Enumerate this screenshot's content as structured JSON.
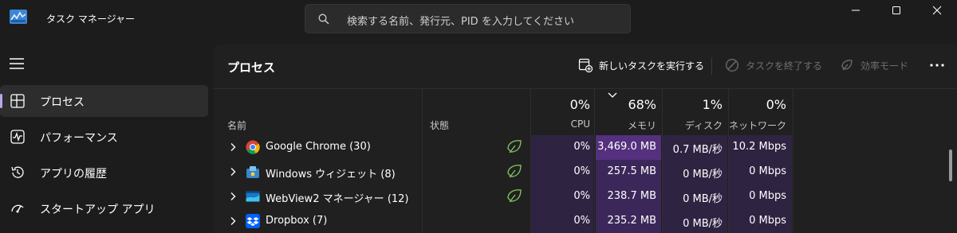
{
  "app": {
    "title": "タスク マネージャー"
  },
  "search": {
    "placeholder": "検索する名前、発行元、PID を入力してください"
  },
  "sidebar": {
    "items": [
      {
        "label": "プロセス",
        "icon": "processes-icon",
        "active": true
      },
      {
        "label": "パフォーマンス",
        "icon": "performance-icon",
        "active": false
      },
      {
        "label": "アプリの履歴",
        "icon": "history-icon",
        "active": false
      },
      {
        "label": "スタートアップ アプリ",
        "icon": "startup-icon",
        "active": false
      }
    ]
  },
  "toolbar": {
    "title": "プロセス",
    "run_new_task": "新しいタスクを実行する",
    "end_task": "タスクを終了する",
    "efficiency_mode": "効率モード"
  },
  "columns": {
    "name": "名前",
    "status": "状態",
    "cpu": {
      "label": "CPU",
      "percent": "0%"
    },
    "memory": {
      "label": "メモリ",
      "percent": "68%"
    },
    "disk": {
      "label": "ディスク",
      "percent": "1%"
    },
    "network": {
      "label": "ネットワーク",
      "percent": "0%"
    }
  },
  "processes": [
    {
      "name": "Google Chrome (30)",
      "icon": "chrome-icon",
      "efficiency": true,
      "cpu": "0%",
      "memory": "3,469.0 MB",
      "disk": "0.7 MB/秒",
      "network": "10.2 Mbps"
    },
    {
      "name": "Windows ウィジェット (8)",
      "icon": "widgets-icon",
      "efficiency": true,
      "cpu": "0%",
      "memory": "257.5 MB",
      "disk": "0 MB/秒",
      "network": "0 Mbps"
    },
    {
      "name": "WebView2 マネージャー (12)",
      "icon": "webview2-icon",
      "efficiency": true,
      "cpu": "0%",
      "memory": "238.7 MB",
      "disk": "0 MB/秒",
      "network": "0 Mbps"
    },
    {
      "name": "Dropbox (7)",
      "icon": "dropbox-icon",
      "efficiency": false,
      "cpu": "0%",
      "memory": "235.2 MB",
      "disk": "0 MB/秒",
      "network": "0 Mbps"
    }
  ],
  "colors": {
    "background": "#1c1c1c",
    "panel": "#202020",
    "accent": "#b8a6e8",
    "cpu_cell": "#2f2342",
    "memory_cell_high": "#54307e",
    "memory_cell_low": "#3c275a",
    "disk_cell": "#2f2342",
    "efficiency_leaf": "#7fbf5f"
  }
}
